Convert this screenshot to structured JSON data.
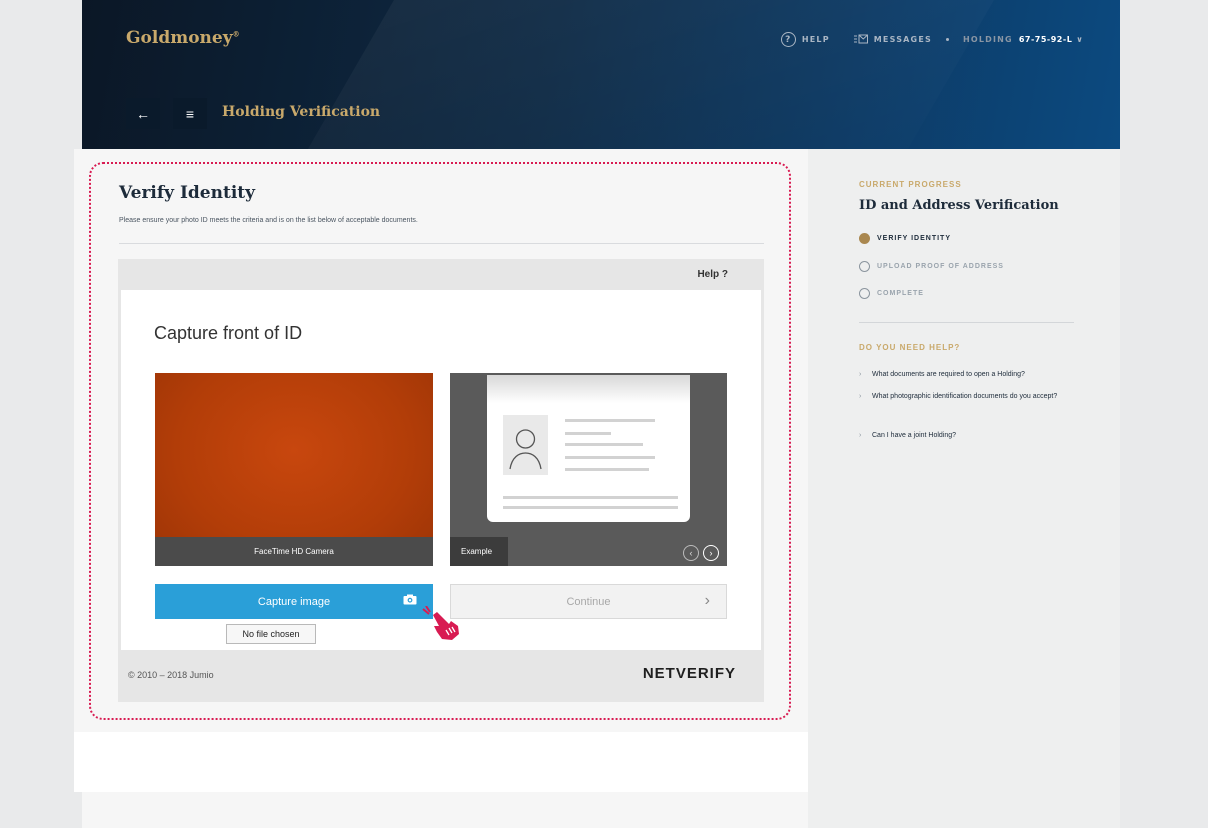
{
  "header": {
    "logo": "Goldmoney",
    "logo_mark": "®",
    "nav": {
      "help_label": "HELP",
      "messages_label": "MESSAGES",
      "holding_label": "HOLDING",
      "holding_value": "67-75-92-L",
      "holding_chevron": "∨"
    },
    "back_icon": "←",
    "menu_icon": "≡",
    "page_title": "Holding Verification"
  },
  "main": {
    "title": "Verify Identity",
    "subtitle": "Please ensure your photo ID meets the criteria and is on the list below of acceptable documents."
  },
  "widget": {
    "help_link": "Help ?",
    "capture_title": "Capture front of ID",
    "camera_label": "FaceTime HD Camera",
    "example_label": "Example",
    "prev_icon": "‹",
    "next_icon": "›",
    "capture_button": "Capture image",
    "continue_button": "Continue",
    "continue_chevron": "›",
    "file_tooltip": "No file chosen",
    "copyright": "© 2010 – 2018 Jumio",
    "brand": "NETVERIFY"
  },
  "sidebar": {
    "progress_label": "CURRENT PROGRESS",
    "progress_title": "ID and Address Verification",
    "steps": [
      {
        "label": "VERIFY IDENTITY",
        "state": "active"
      },
      {
        "label": "UPLOAD PROOF OF ADDRESS",
        "state": "todo"
      },
      {
        "label": "COMPLETE",
        "state": "todo"
      }
    ],
    "help_title": "DO YOU NEED HELP?",
    "faq": [
      "What documents are required to open a Holding?",
      "What photographic identification documents do you accept?",
      "Can I have a joint Holding?"
    ],
    "faq_arrow": "›"
  },
  "colors": {
    "gold": "#c9a96b",
    "navy": "#1d2b3a",
    "capture_blue": "#2a9fd8",
    "highlight_red": "#d81b52"
  }
}
